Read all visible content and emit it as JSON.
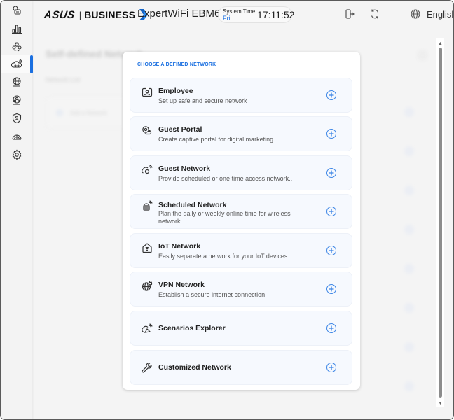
{
  "header": {
    "brand": "ASUS",
    "brand_suffix": "BUSINESS",
    "separator": "|",
    "model": "ExpertWiFi EBM68",
    "system_time_label": "System Time",
    "system_day": "Fri",
    "system_clock": "17:11:52",
    "language": "English",
    "icons": [
      "logout-icon",
      "refresh-icon",
      "globe-icon"
    ]
  },
  "sidebar": {
    "items": [
      {
        "icon": "dashboard-icon",
        "active": false
      },
      {
        "icon": "statistics-icon",
        "active": false
      },
      {
        "icon": "network-users-icon",
        "active": false
      },
      {
        "icon": "self-defined-network-icon",
        "active": true
      },
      {
        "icon": "wan-globe-icon",
        "active": false
      },
      {
        "icon": "lan-icon",
        "active": false
      },
      {
        "icon": "security-shield-icon",
        "active": false
      },
      {
        "icon": "vpn-icon",
        "active": false
      },
      {
        "icon": "settings-gear-icon",
        "active": false
      }
    ]
  },
  "background": {
    "title": "Self-defined Network",
    "subtitle": "Network List",
    "card_label": "Add a Network"
  },
  "modal": {
    "title": "CHOOSE A DEFINED NETWORK",
    "accent_color": "#1a6fe0",
    "networks": [
      {
        "name": "Employee",
        "description": "Set up safe and secure network",
        "icon": "employee-badge-icon"
      },
      {
        "name": "Guest Portal",
        "description": "Create captive portal for digital marketing.",
        "icon": "guest-portal-icon"
      },
      {
        "name": "Guest Network",
        "description": "Provide scheduled or one time access network..",
        "icon": "guest-network-icon"
      },
      {
        "name": "Scheduled Network",
        "description": "Plan the daily or weekly online time for wireless network.",
        "icon": "scheduled-network-icon"
      },
      {
        "name": "IoT Network",
        "description": "Easily separate a network for your IoT devices",
        "icon": "iot-home-icon"
      },
      {
        "name": "VPN Network",
        "description": "Establish a secure internet connection",
        "icon": "vpn-globe-icon"
      },
      {
        "name": "Scenarios Explorer",
        "description": "",
        "icon": "scenarios-explorer-icon"
      },
      {
        "name": "Customized Network",
        "description": "",
        "icon": "wrench-icon"
      }
    ]
  }
}
